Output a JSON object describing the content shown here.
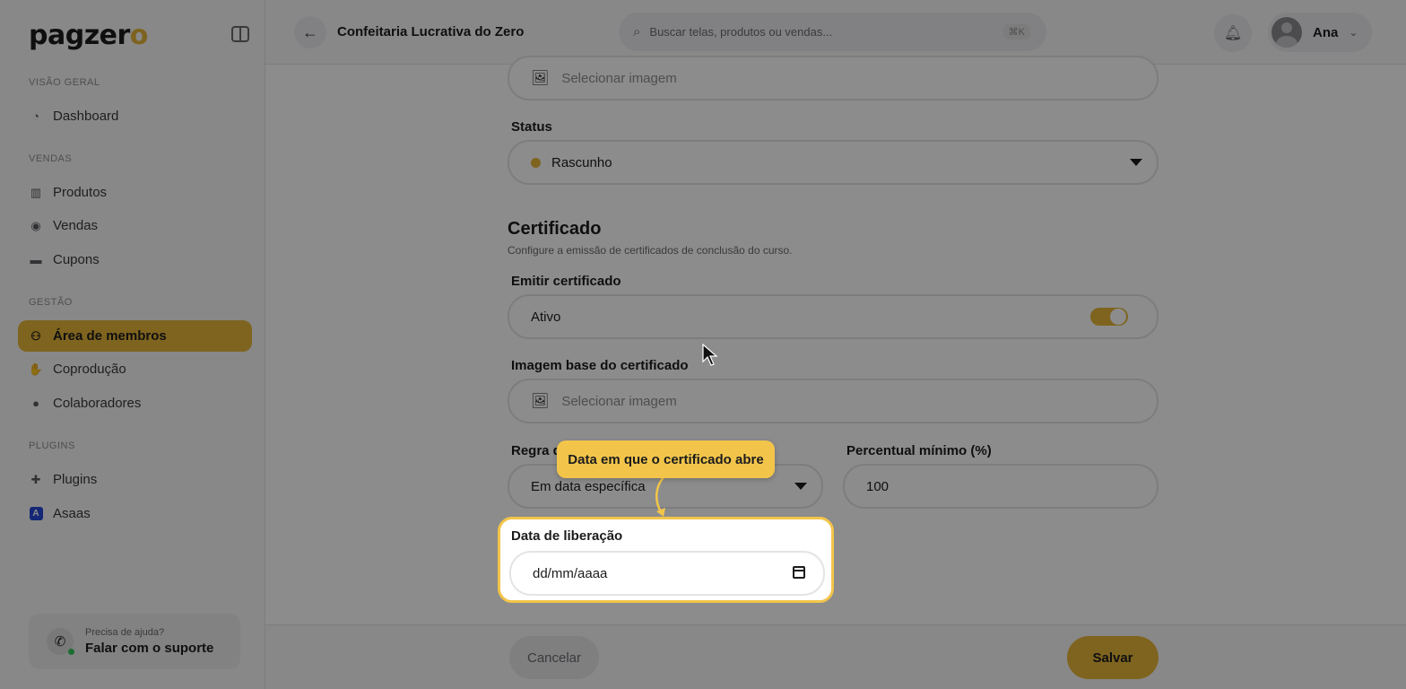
{
  "sidebar": {
    "logo_main": "pagzer",
    "logo_accent": "o",
    "sections": [
      {
        "label": "VISÃO GERAL"
      },
      {
        "label": "VENDAS"
      },
      {
        "label": "GESTÃO"
      },
      {
        "label": "PLUGINS"
      }
    ],
    "items": [
      {
        "label": "Dashboard",
        "icon": "chart-icon"
      },
      {
        "label": "Produtos",
        "icon": "products-icon"
      },
      {
        "label": "Vendas",
        "icon": "sales-icon"
      },
      {
        "label": "Cupons",
        "icon": "coupon-icon"
      },
      {
        "label": "Área de membros",
        "icon": "members-icon",
        "active": true
      },
      {
        "label": "Coprodução",
        "icon": "handshake-icon"
      },
      {
        "label": "Colaboradores",
        "icon": "user-icon"
      },
      {
        "label": "Plugins",
        "icon": "puzzle-icon"
      },
      {
        "label": "Asaas",
        "icon": "asaas-icon",
        "icon_text": "A"
      }
    ],
    "support": {
      "small": "Precisa de ajuda?",
      "big": "Falar com o suporte"
    }
  },
  "header": {
    "course_title": "Confeitaria Lucrativa do Zero",
    "search_placeholder": "Buscar telas, produtos ou vendas...",
    "shortcut": "⌘K",
    "user_name": "Ana"
  },
  "form": {
    "image_field_1": "Selecionar imagem",
    "status_label": "Status",
    "status_value": "Rascunho",
    "status_color": "#e8b63a",
    "certificate_title": "Certificado",
    "certificate_desc": "Configure a emissão de certificados de conclusão do curso.",
    "emit_label": "Emitir certificado",
    "emit_value": "Ativo",
    "emit_on": true,
    "base_image_label": "Imagem base do certificado",
    "base_image_value": "Selecionar imagem",
    "rule_label": "Regra d",
    "rule_value": "Em data específica",
    "min_percent_label": "Percentual mínimo (%)",
    "min_percent_value": "100",
    "release_label": "Data de liberação",
    "release_placeholder": "dd/mm/aaaa"
  },
  "tooltip": {
    "text": "Data em que o certificado abre"
  },
  "footer": {
    "cancel": "Cancelar",
    "save": "Salvar"
  },
  "colors": {
    "accent": "#e8b63a",
    "highlight": "#f2c54a"
  }
}
